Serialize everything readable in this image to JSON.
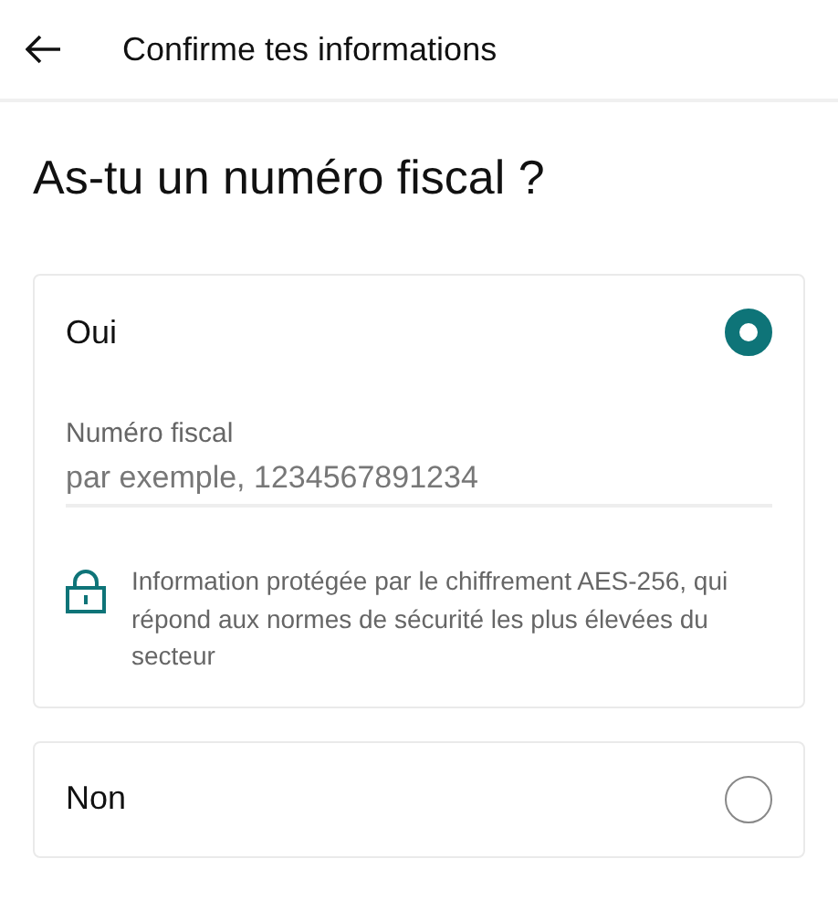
{
  "header": {
    "title": "Confirme tes informations"
  },
  "question": "As-tu un numéro fiscal ?",
  "options": [
    {
      "label": "Oui",
      "selected": true,
      "field": {
        "label": "Numéro fiscal",
        "placeholder": "par exemple, 1234567891234"
      },
      "note": "Information protégée par le chiffrement AES-256, qui répond aux normes de sécurité les plus élevées du secteur"
    },
    {
      "label": "Non",
      "selected": false
    }
  ]
}
